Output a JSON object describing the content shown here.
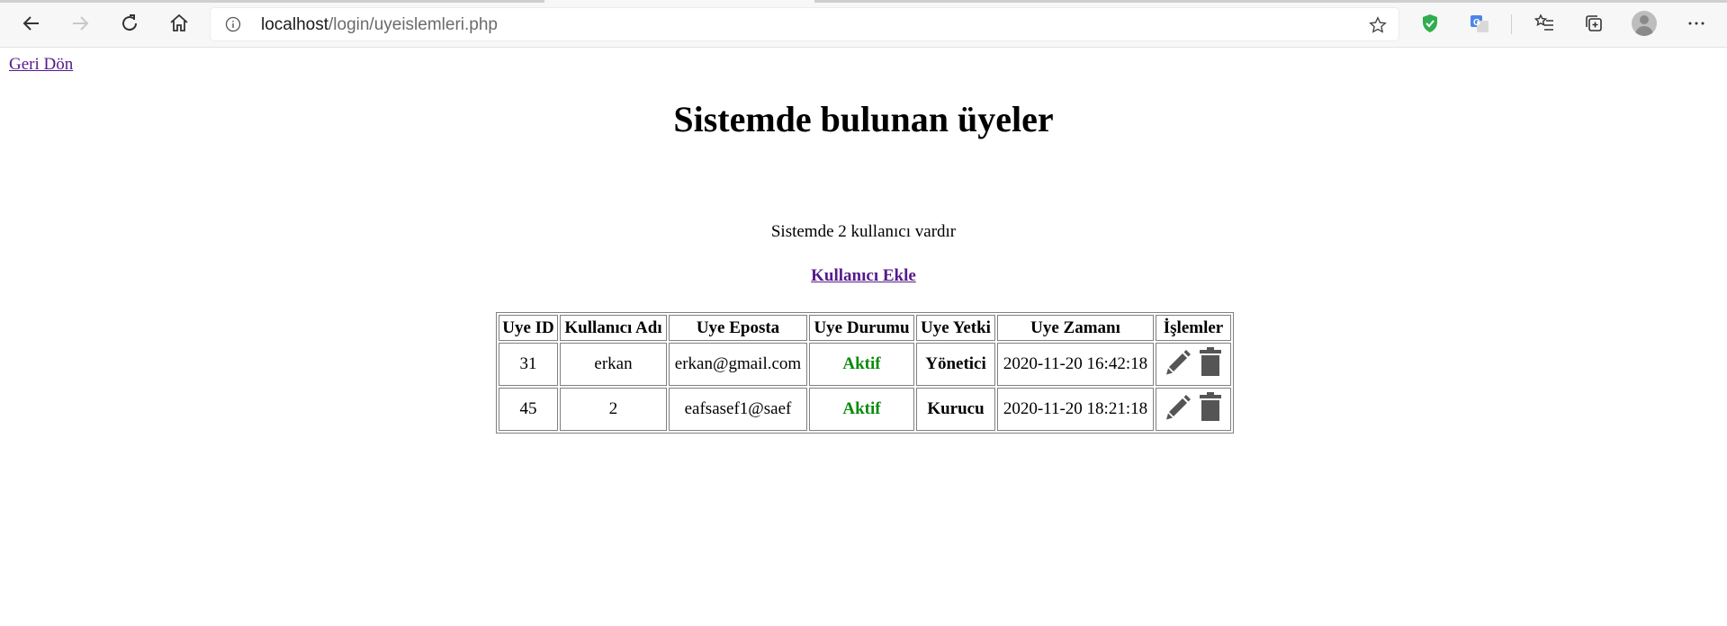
{
  "browser": {
    "url_host": "localhost",
    "url_path": "/login/uyeislemleri.php"
  },
  "page": {
    "back_link": "Geri Dön",
    "title": "Sistemde bulunan üyeler",
    "count_text": "Sistemde 2 kullanıcı vardır",
    "add_user_link": "Kullanıcı Ekle"
  },
  "table": {
    "headers": [
      "Uye ID",
      "Kullanıcı Adı",
      "Uye Eposta",
      "Uye Durumu",
      "Uye Yetki",
      "Uye Zamanı",
      "İşlemler"
    ],
    "rows": [
      {
        "id": "31",
        "username": "erkan",
        "email": "erkan@gmail.com",
        "status": "Aktif",
        "role": "Yönetici",
        "time": "2020-11-20 16:42:18"
      },
      {
        "id": "45",
        "username": "2",
        "email": "eafsasef1@saef",
        "status": "Aktif",
        "role": "Kurucu",
        "time": "2020-11-20 18:21:18"
      }
    ]
  },
  "colors": {
    "status_active": "#0b8a0b",
    "link_visited": "#551a8b",
    "icon_gray": "#555555"
  },
  "icons": [
    "back-arrow-icon",
    "forward-arrow-icon",
    "refresh-icon",
    "home-icon",
    "info-icon",
    "star-icon",
    "shield-icon",
    "translate-icon",
    "favorites-icon",
    "collections-icon",
    "profile-icon",
    "more-icon",
    "pencil-icon",
    "trash-icon"
  ]
}
